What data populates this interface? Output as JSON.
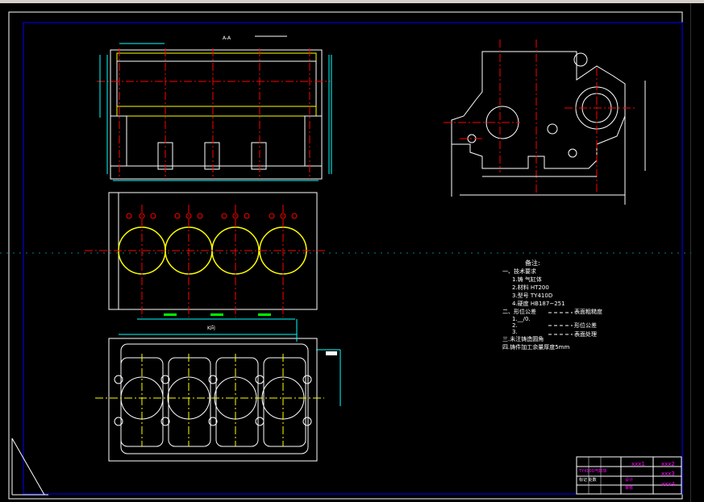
{
  "drawing": {
    "section_label": "A-A",
    "view_label": "K向",
    "notes_title": "备注:",
    "notes": [
      "一、技术要求",
      "1.铸  气缸体",
      "2.材料 HT200",
      "3.型号 TY410D",
      "4.硬度 HB187~251",
      "二、形位公差",
      "1.__/0.",
      "2.",
      "3.",
      "三.未注铸造圆角",
      "四.铸件加工余量厚度5mm"
    ],
    "legend": [
      "表面粗糙度",
      "形位公差",
      "表面处理"
    ],
    "title_block": {
      "name_cells": [
        "xxx1",
        "xxx2",
        "xxx3",
        "xxx4"
      ],
      "magenta_row": "TY410D气缸体",
      "rows": [
        "标记 处数",
        "设计",
        "审核"
      ]
    }
  },
  "colors": {
    "outline": "#ffffff",
    "centerline": "#ff0000",
    "frame": "#0000ff",
    "bore": "#ffff00",
    "dimension": "#00ffff",
    "green": "#00ff00",
    "magenta": "#ff00ff"
  }
}
